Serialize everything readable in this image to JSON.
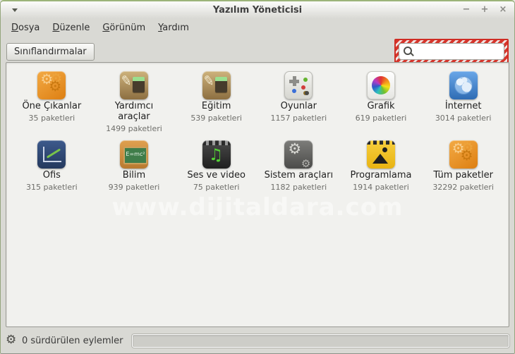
{
  "window": {
    "title": "Yazılım Yöneticisi",
    "controls": {
      "minimize": "−",
      "maximize": "+",
      "close": "×"
    }
  },
  "menubar": {
    "items": [
      "Dosya",
      "Düzenle",
      "Görünüm",
      "Yardım"
    ]
  },
  "toolbar": {
    "categories_button": "Sınıflandırmalar",
    "search": {
      "value": "",
      "placeholder": ""
    }
  },
  "categories": [
    {
      "label": "Öne Çıkanlar",
      "count": "35 paketleri",
      "icon": "featured"
    },
    {
      "label": "Yardımcı araçlar",
      "count": "1499 paketleri",
      "icon": "accessories"
    },
    {
      "label": "Eğitim",
      "count": "539 paketleri",
      "icon": "education"
    },
    {
      "label": "Oyunlar",
      "count": "1157 paketleri",
      "icon": "games"
    },
    {
      "label": "Grafik",
      "count": "619 paketleri",
      "icon": "graphics"
    },
    {
      "label": "İnternet",
      "count": "3014 paketleri",
      "icon": "internet"
    },
    {
      "label": "Ofis",
      "count": "315 paketleri",
      "icon": "office"
    },
    {
      "label": "Bilim",
      "count": "939 paketleri",
      "icon": "science"
    },
    {
      "label": "Ses ve video",
      "count": "75 paketleri",
      "icon": "sound-video"
    },
    {
      "label": "Sistem araçları",
      "count": "1182 paketleri",
      "icon": "system-tools"
    },
    {
      "label": "Programlama",
      "count": "1914 paketleri",
      "icon": "programming"
    },
    {
      "label": "Tüm paketler",
      "count": "32292 paketleri",
      "icon": "all-packages"
    }
  ],
  "statusbar": {
    "text": "0 sürdürülen eylemler"
  },
  "watermark": "www.dijitaldara.com",
  "colors": {
    "titlebar_green_edge": "#9cb47a",
    "highlight_red": "#cf2d24",
    "chrome_gray": "#d9d9d4",
    "content_bg": "#f1f1ee"
  }
}
